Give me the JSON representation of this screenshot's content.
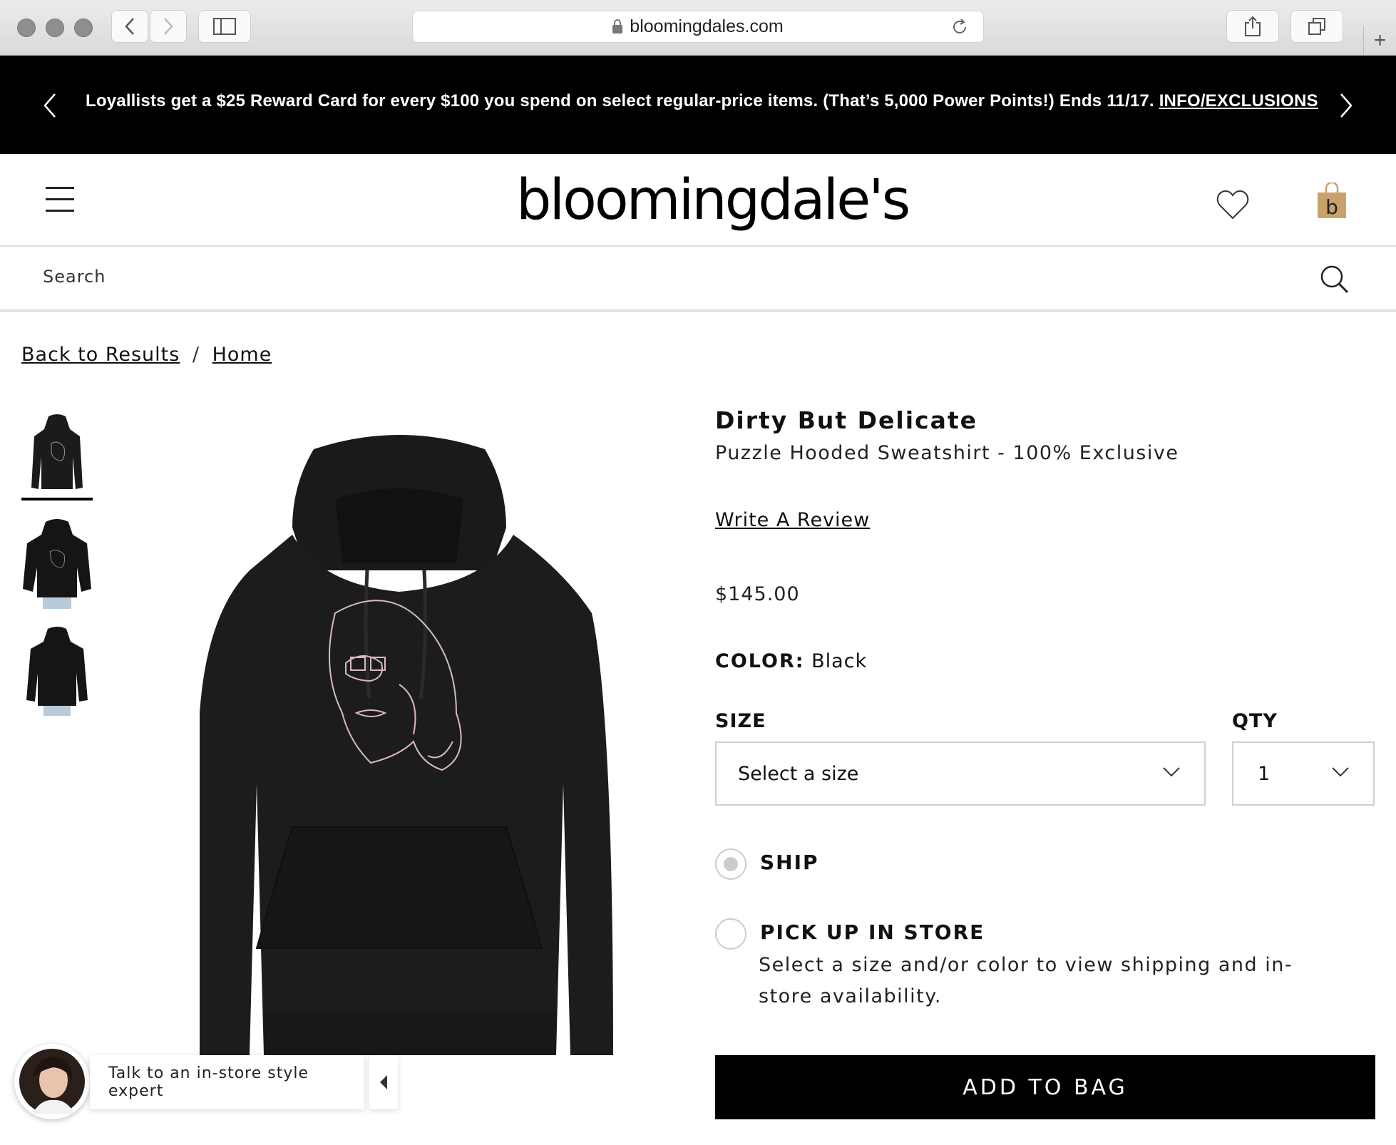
{
  "browser": {
    "url": "bloomingdales.com"
  },
  "promo": {
    "text": "Loyallists get a $25 Reward Card for every $100 you spend on select regular-price items. (That’s 5,000 Power Points!) Ends 11/17.",
    "link_label": "INFO/EXCLUSIONS"
  },
  "header": {
    "logo_text": "bloomingdale's",
    "bag_letter": "b",
    "bag_color": "#c9a26b"
  },
  "search": {
    "placeholder": "Search"
  },
  "breadcrumb": {
    "back_label": "Back to Results",
    "separator": "/",
    "home_label": "Home"
  },
  "product": {
    "brand": "Dirty But Delicate",
    "name": "Puzzle Hooded Sweatshirt - 100% Exclusive",
    "review_link": "Write A Review",
    "price": "$145.00",
    "color_label": "COLOR:",
    "color_value": "Black",
    "size_label": "SIZE",
    "size_value": "Select a size",
    "qty_label": "QTY",
    "qty_value": "1",
    "ship_label": "SHIP",
    "pickup_label": "PICK UP IN STORE",
    "availability_text": "Select a size and/or color to view shipping and in-store availability.",
    "add_to_bag_label": "ADD TO BAG"
  },
  "chat": {
    "text": "Talk to an in-store style expert"
  }
}
